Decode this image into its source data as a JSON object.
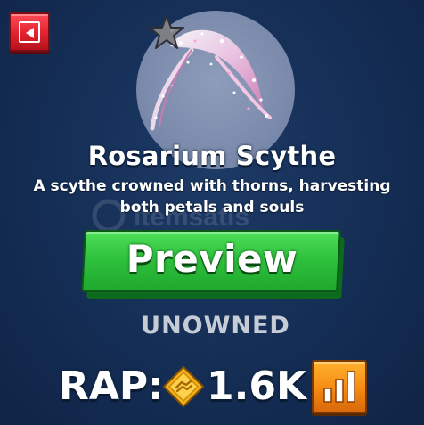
{
  "screen": {
    "background_color": "#163058"
  },
  "back_button": {
    "icon": "back-arrow-icon",
    "color": "#e0222f"
  },
  "item": {
    "name": "Rosarium Scythe",
    "description": "A scythe crowned with thorns, harvesting both petals and souls",
    "image_icon": "scythe-icon",
    "rarity_icon": "star-icon",
    "rarity_star_color": "#7d7f85"
  },
  "watermark": {
    "brand": "itemsatis"
  },
  "preview_button": {
    "label": "Preview",
    "color": "#2fc23d"
  },
  "ownership": {
    "status": "UNOWNED"
  },
  "rap": {
    "label": "RAP:",
    "value": "1.6K",
    "currency_icon": "robux-coin-icon",
    "chart_icon": "bar-chart-icon",
    "chart_button_color": "#f58a12"
  }
}
